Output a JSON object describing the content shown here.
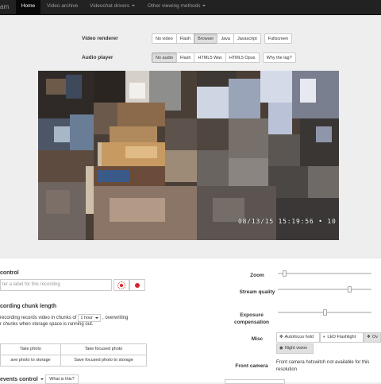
{
  "navbar": {
    "brand": "am",
    "items": [
      {
        "label": "Home",
        "active": true
      },
      {
        "label": "Video archive"
      },
      {
        "label": "Videochat drivers",
        "dropdown": true
      },
      {
        "label": "Other viewing methods",
        "dropdown": true
      }
    ]
  },
  "renderer": {
    "label": "Video renderer",
    "options": [
      "No video",
      "Flash",
      "Browser",
      "Java",
      "Javascript",
      "Fullscreen"
    ],
    "selected": "Browser"
  },
  "audio": {
    "label": "Audio player",
    "options": [
      "No audio",
      "Flash",
      "HTML5 Wav",
      "HTML5 Opus"
    ],
    "selected": "No audio",
    "help": "Why the lag?"
  },
  "video": {
    "timestamp": "08/13/15 15:19:56 • 10"
  },
  "recording": {
    "title": "control",
    "placeholder": "ter a label for this recording"
  },
  "chunk": {
    "title": "cording chunk length",
    "line1_pre": "recording records video in chunks of",
    "select": "1 hour",
    "line1_post": ", overwriting",
    "line2": "r chunks when storage space is running out."
  },
  "photo": {
    "take": "Take photo",
    "take_focused": "Take focused photo",
    "save": "ave photo to storage",
    "save_focused": "Save focused photo to storage"
  },
  "events": {
    "title": "events control",
    "help": "What is this?"
  },
  "right": {
    "zoom_label": "Zoom",
    "quality_label": "Stream quality",
    "exposure_label": "Exposure compensation",
    "misc_label": "Misc",
    "front_label": "Front camera",
    "zoom_value": 0.0,
    "quality_value": 0.8,
    "exposure_value": 0.5
  },
  "misc": {
    "autofocus": "Autofocus hold",
    "led": "LED Flashlight",
    "overlay": "Ov",
    "night": "Night vision"
  },
  "front": {
    "line1": "Front camera hotswitch not available for this",
    "line2": "resolution"
  },
  "colors": {
    "navbar": "#222222",
    "record_red": "#d9242b",
    "top_bg": "#eeeeee",
    "bottom_bg": "#ffffff"
  }
}
